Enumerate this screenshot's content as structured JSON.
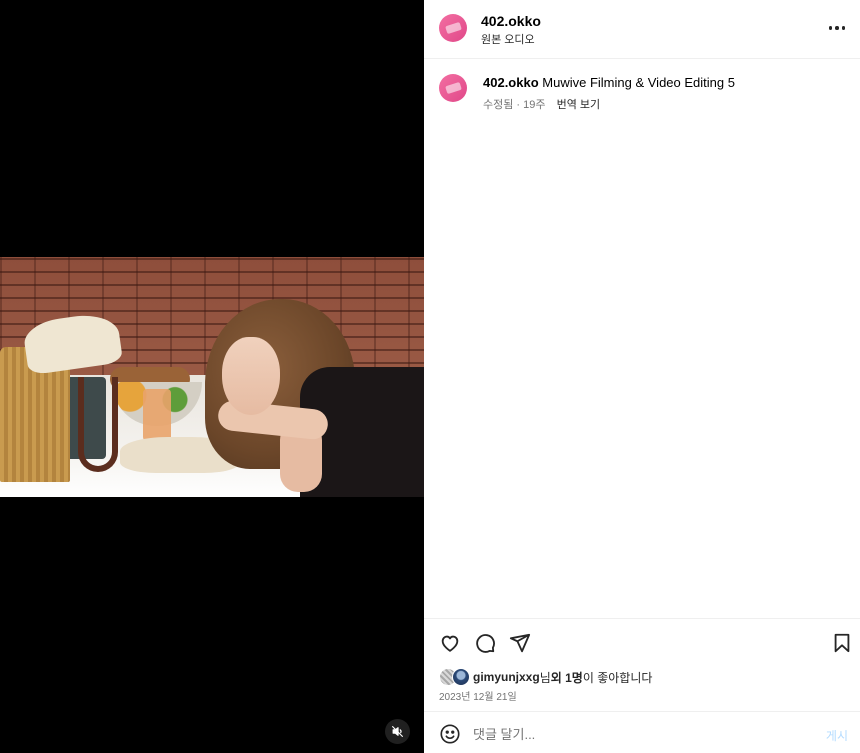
{
  "post": {
    "username": "402.okko",
    "audio_label": "원본 오디오",
    "more_icon": "more-horizontal-icon",
    "avatar_colors": [
      "#f36fa2",
      "#e04889"
    ]
  },
  "caption": {
    "username": "402.okko",
    "text": "Muwive Filming & Video Editing 5",
    "edited": "수정됨",
    "separator": " · ",
    "age": "19주",
    "translate_label": "번역 보기"
  },
  "actions": {
    "like_icon": "heart-icon",
    "comment_icon": "comment-icon",
    "share_icon": "send-icon",
    "save_icon": "bookmark-icon"
  },
  "likes": {
    "liker": "gimyunjxxg",
    "suffix_1": "님 ",
    "others": "외 1명",
    "suffix_2": "이 좋아합니다"
  },
  "date": "2023년 12월 21일",
  "comment": {
    "placeholder": "댓글 달기...",
    "post_label": "게시",
    "emoji_icon": "smile-icon"
  },
  "media": {
    "mute_icon": "speaker-muted-icon"
  },
  "colors": {
    "post_button_disabled": "#b3dbff",
    "secondary_text": "#737373",
    "divider": "#efefef"
  }
}
